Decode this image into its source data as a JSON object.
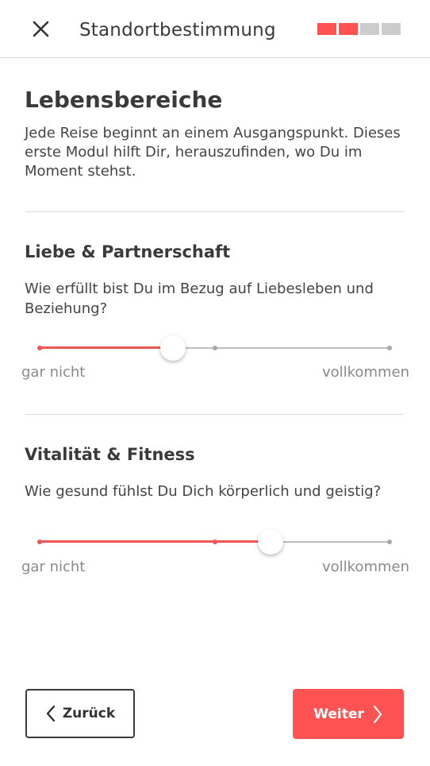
{
  "header": {
    "title": "Standortbestimmung",
    "close_icon": "close-icon",
    "progress": {
      "total": 4,
      "completed": 2
    }
  },
  "colors": {
    "accent": "#ff5252",
    "slider_fill": "#ef5555",
    "inactive": "#cccccc",
    "track": "#bdbdbd",
    "text": "#3a3a3a",
    "muted": "#8a8a8a"
  },
  "intro": {
    "title": "Lebensbereiche",
    "text": "Jede Reise beginnt an einem Ausgangspunkt. Dieses erste Modul hilft Dir, herauszufinden, wo Du im Moment stehst."
  },
  "sections": [
    {
      "title": "Liebe & Partnerschaft",
      "question": "Wie erfüllt bist Du im Bezug auf Liebesleben und Beziehung?",
      "value": 0.38,
      "min_label": "gar nicht",
      "max_label": "vollkommen"
    },
    {
      "title": "Vitalität & Fitness",
      "question": "Wie gesund fühlst Du Dich körperlich und geistig?",
      "value": 0.66,
      "min_label": "gar nicht",
      "max_label": "vollkommen"
    }
  ],
  "footer": {
    "back_label": "Zurück",
    "back_icon": "chevron-left-icon",
    "next_label": "Weiter",
    "next_icon": "chevron-right-icon"
  }
}
